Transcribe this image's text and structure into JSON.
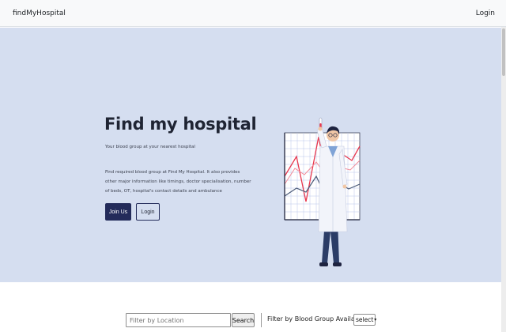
{
  "navbar": {
    "brand": "findMyHospital",
    "login_label": "Login"
  },
  "hero": {
    "title": "Find my hospital",
    "subtitle": "Your blood group at your nearest hospital",
    "description": "Find required blood group at Find My Hospital. It also provides other major information like timings, doctor specialisation, number of beds, OT, hospital's contact details and ambulance",
    "join_label": "Join Us",
    "login_label": "Login"
  },
  "filters": {
    "location_placeholder": "Filter by Location",
    "location_value": "",
    "search_label": "Search",
    "blood_group_label": "Filter by Blood Group Availability:",
    "blood_group_selected": "select"
  },
  "colors": {
    "hero_bg": "#d5def0",
    "primary_button": "#232b5a",
    "chart_red": "#e8374e",
    "chart_pink": "#f28a98",
    "chart_slate": "#4a5a78"
  },
  "icons": {
    "select_chevron": "chevron-down-icon"
  }
}
